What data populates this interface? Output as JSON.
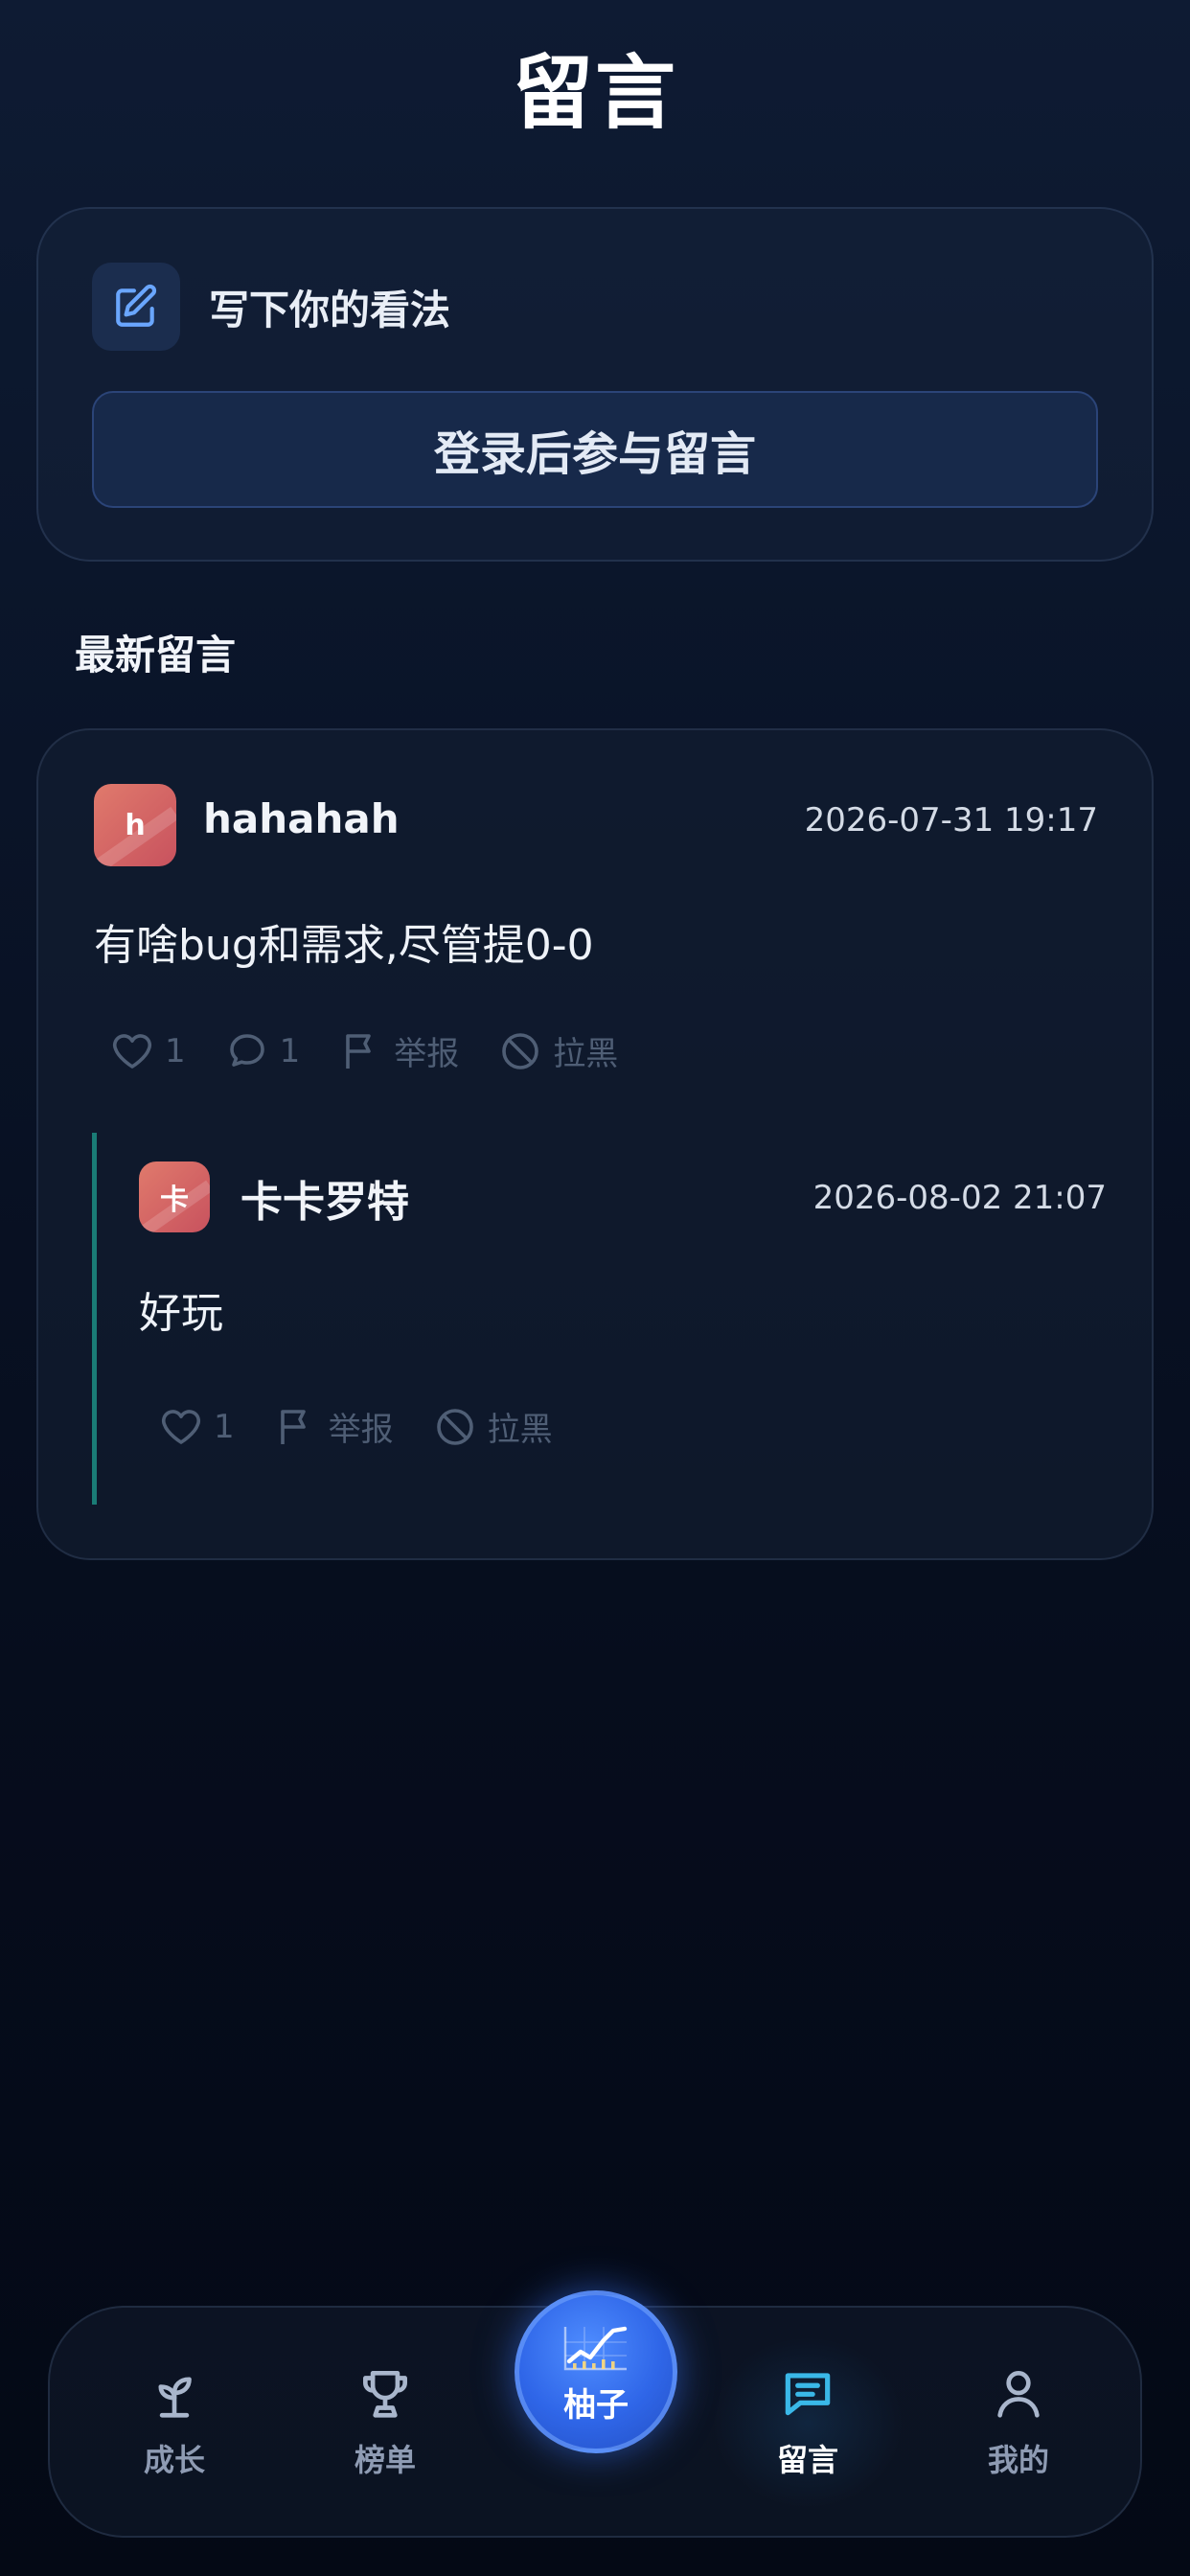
{
  "header": {
    "title": "留言"
  },
  "compose": {
    "prompt": "写下你的看法",
    "login_button": "登录后参与留言",
    "icon": "edit-icon"
  },
  "feed": {
    "section_title": "最新留言",
    "comments": [
      {
        "avatar_letter": "h",
        "author": "hahahah",
        "time": "2026-07-31 19:17",
        "text": "有啥bug和需求,尽管提0-0",
        "like_count": "1",
        "reply_count": "1",
        "report_label": "举报",
        "block_label": "拉黑",
        "replies": [
          {
            "avatar_letter": "卡",
            "author": "卡卡罗特",
            "time": "2026-08-02 21:07",
            "text": "好玩",
            "like_count": "1",
            "report_label": "举报",
            "block_label": "拉黑"
          }
        ]
      }
    ]
  },
  "nav": {
    "items": [
      {
        "label": "成长",
        "icon": "sprout-icon"
      },
      {
        "label": "榜单",
        "icon": "trophy-icon"
      },
      {
        "label": "柚子",
        "icon": "chart-icon"
      },
      {
        "label": "留言",
        "icon": "message-icon",
        "active": true
      },
      {
        "label": "我的",
        "icon": "user-icon"
      }
    ]
  },
  "colors": {
    "accent_blue": "#2f66e8",
    "active_icon": "#3ab8e8",
    "thread_line": "#1a7c76",
    "avatar": "#d8655f"
  }
}
